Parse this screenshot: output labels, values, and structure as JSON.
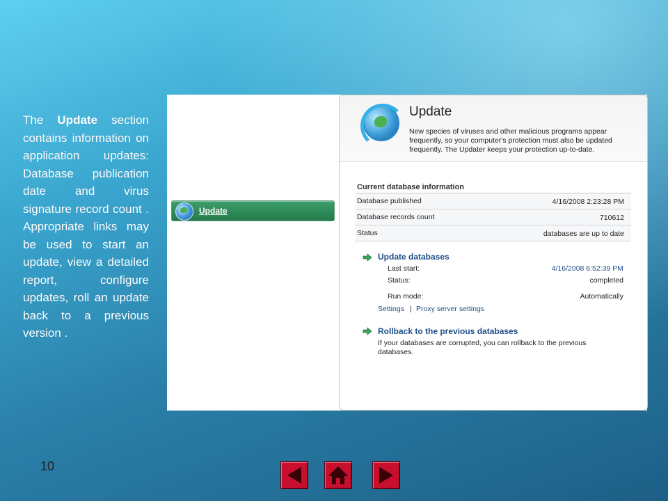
{
  "slide": {
    "description_pre": "The ",
    "description_bold": "Update",
    "description_post": " section contains information on application updates: Database publication date and virus signature record count . Appropriate links may be used to start an update, view a detailed report, configure updates, roll an update back to a previous version .",
    "page_number": "10"
  },
  "sidebar": {
    "update_label": "Update"
  },
  "panel": {
    "title": "Update",
    "description": "New species of viruses and other malicious programs appear frequently, so your computer's protection must also be updated frequently. The Updater keeps your protection up-to-date."
  },
  "database_info": {
    "heading": "Current database information",
    "rows": [
      {
        "label": "Database published",
        "value": "4/16/2008 2:23:28 PM"
      },
      {
        "label": "Database records count",
        "value": "710612"
      },
      {
        "label": "Status",
        "value": "databases are up to date"
      }
    ]
  },
  "update_databases": {
    "title": "Update databases",
    "last_start_label": "Last start:",
    "last_start_value": "4/16/2008 6:52:39 PM",
    "status_label": "Status:",
    "status_value": "completed",
    "run_mode_label": "Run mode:",
    "run_mode_value": "Automatically",
    "settings_link": "Settings",
    "separator": "|",
    "proxy_link": "Proxy server settings"
  },
  "rollback": {
    "title": "Rollback to the previous databases",
    "description": "If your databases are corrupted, you can rollback to the previous databases."
  },
  "colors": {
    "nav_button": "#c8102e",
    "link": "#1f4f8a",
    "link_value": "#1f4f8a"
  },
  "icons": [
    "globe-update-icon",
    "green-arrow-icon",
    "prev-slide-icon",
    "home-icon",
    "next-slide-icon"
  ]
}
